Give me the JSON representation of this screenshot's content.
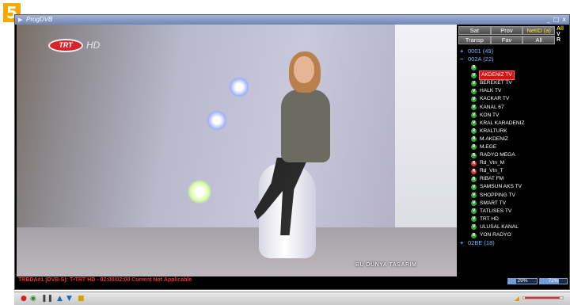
{
  "step_badge": "5",
  "app": {
    "title": "ProgDVB",
    "controls": [
      "_",
      "□",
      "x"
    ]
  },
  "video": {
    "channel_logo": "TRT",
    "channel_hd": "HD",
    "caption": "BU DÜNYA TASARIM"
  },
  "panel": {
    "tabs_row1": [
      {
        "label": "Sat",
        "active": false
      },
      {
        "label": "Prov",
        "active": false
      },
      {
        "label": "NetID (a)",
        "active": true
      }
    ],
    "tabs_row2": [
      {
        "label": "Transp",
        "active": false
      },
      {
        "label": "Fav",
        "active": false
      },
      {
        "label": "All",
        "active": false
      }
    ],
    "vertical_text": [
      "All",
      "V",
      "R"
    ],
    "groups": [
      {
        "expander": "+",
        "label": "0001 (49)"
      },
      {
        "expander": "−",
        "label": "002A (22)",
        "channels": [
          {
            "badge": "R",
            "type": "radio",
            "label": "",
            "selected": false
          },
          {
            "badge": "V",
            "type": "tv",
            "label": "AKDENIZ TV",
            "selected": true
          },
          {
            "badge": "V",
            "type": "tv",
            "label": "BEREKET TV",
            "selected": false
          },
          {
            "badge": "V",
            "type": "tv",
            "label": "HALK TV",
            "selected": false
          },
          {
            "badge": "V",
            "type": "tv",
            "label": "KACKAR TV",
            "selected": false
          },
          {
            "badge": "V",
            "type": "tv",
            "label": "KANAL 67",
            "selected": false
          },
          {
            "badge": "V",
            "type": "tv",
            "label": "KON TV",
            "selected": false
          },
          {
            "badge": "V",
            "type": "tv",
            "label": "KRAL KARADENIZ",
            "selected": false
          },
          {
            "badge": "R",
            "type": "radio",
            "label": "KRALTURK",
            "selected": false
          },
          {
            "badge": "R",
            "type": "radio",
            "label": "M.AKDENIZ",
            "selected": false
          },
          {
            "badge": "R",
            "type": "radio",
            "label": "M.EGE",
            "selected": false
          },
          {
            "badge": "R",
            "type": "radio",
            "label": "RADYO MEGA",
            "selected": false
          },
          {
            "badge": "R",
            "type": "red",
            "label": "Rd_Vtn_M",
            "selected": false
          },
          {
            "badge": "R",
            "type": "red",
            "label": "Rd_Vtn_T",
            "selected": false
          },
          {
            "badge": "R",
            "type": "radio",
            "label": "RIBAT FM",
            "selected": false
          },
          {
            "badge": "V",
            "type": "tv",
            "label": "SAMSUN AKS TV",
            "selected": false
          },
          {
            "badge": "V",
            "type": "tv",
            "label": "SHOPPING TV",
            "selected": false
          },
          {
            "badge": "V",
            "type": "tv",
            "label": "SMART TV",
            "selected": false
          },
          {
            "badge": "V",
            "type": "tv",
            "label": "TATLISES TV",
            "selected": false
          },
          {
            "badge": "V",
            "type": "tv",
            "label": "TRT HD",
            "selected": false
          },
          {
            "badge": "V",
            "type": "tv",
            "label": "ULUSAL KANAL",
            "selected": false
          },
          {
            "badge": "R",
            "type": "radio",
            "label": "YON RADYO",
            "selected": false
          }
        ]
      },
      {
        "expander": "+",
        "label": "02BE (18)"
      }
    ]
  },
  "status": {
    "text": "TRBDA#1 (DVB-S): T•TRT HD - 02:00/02:00 Current Not Applicable",
    "meter1": {
      "label": "29%",
      "value": 0.29
    },
    "meter2": {
      "label": "72%",
      "value": 0.72
    }
  },
  "colors": {
    "tv_badge": "#2fa82f",
    "radio_badge": "#2fa82f",
    "red_badge": "#e03030",
    "group_text": "#6fb4ff",
    "status_text": "#e83232",
    "selected_bg": "#d21414"
  },
  "taskbar": {
    "icons": [
      "record-icon",
      "eye-icon",
      "pause-icon",
      "settings-icon",
      "scan-icon",
      "folder-icon"
    ]
  }
}
